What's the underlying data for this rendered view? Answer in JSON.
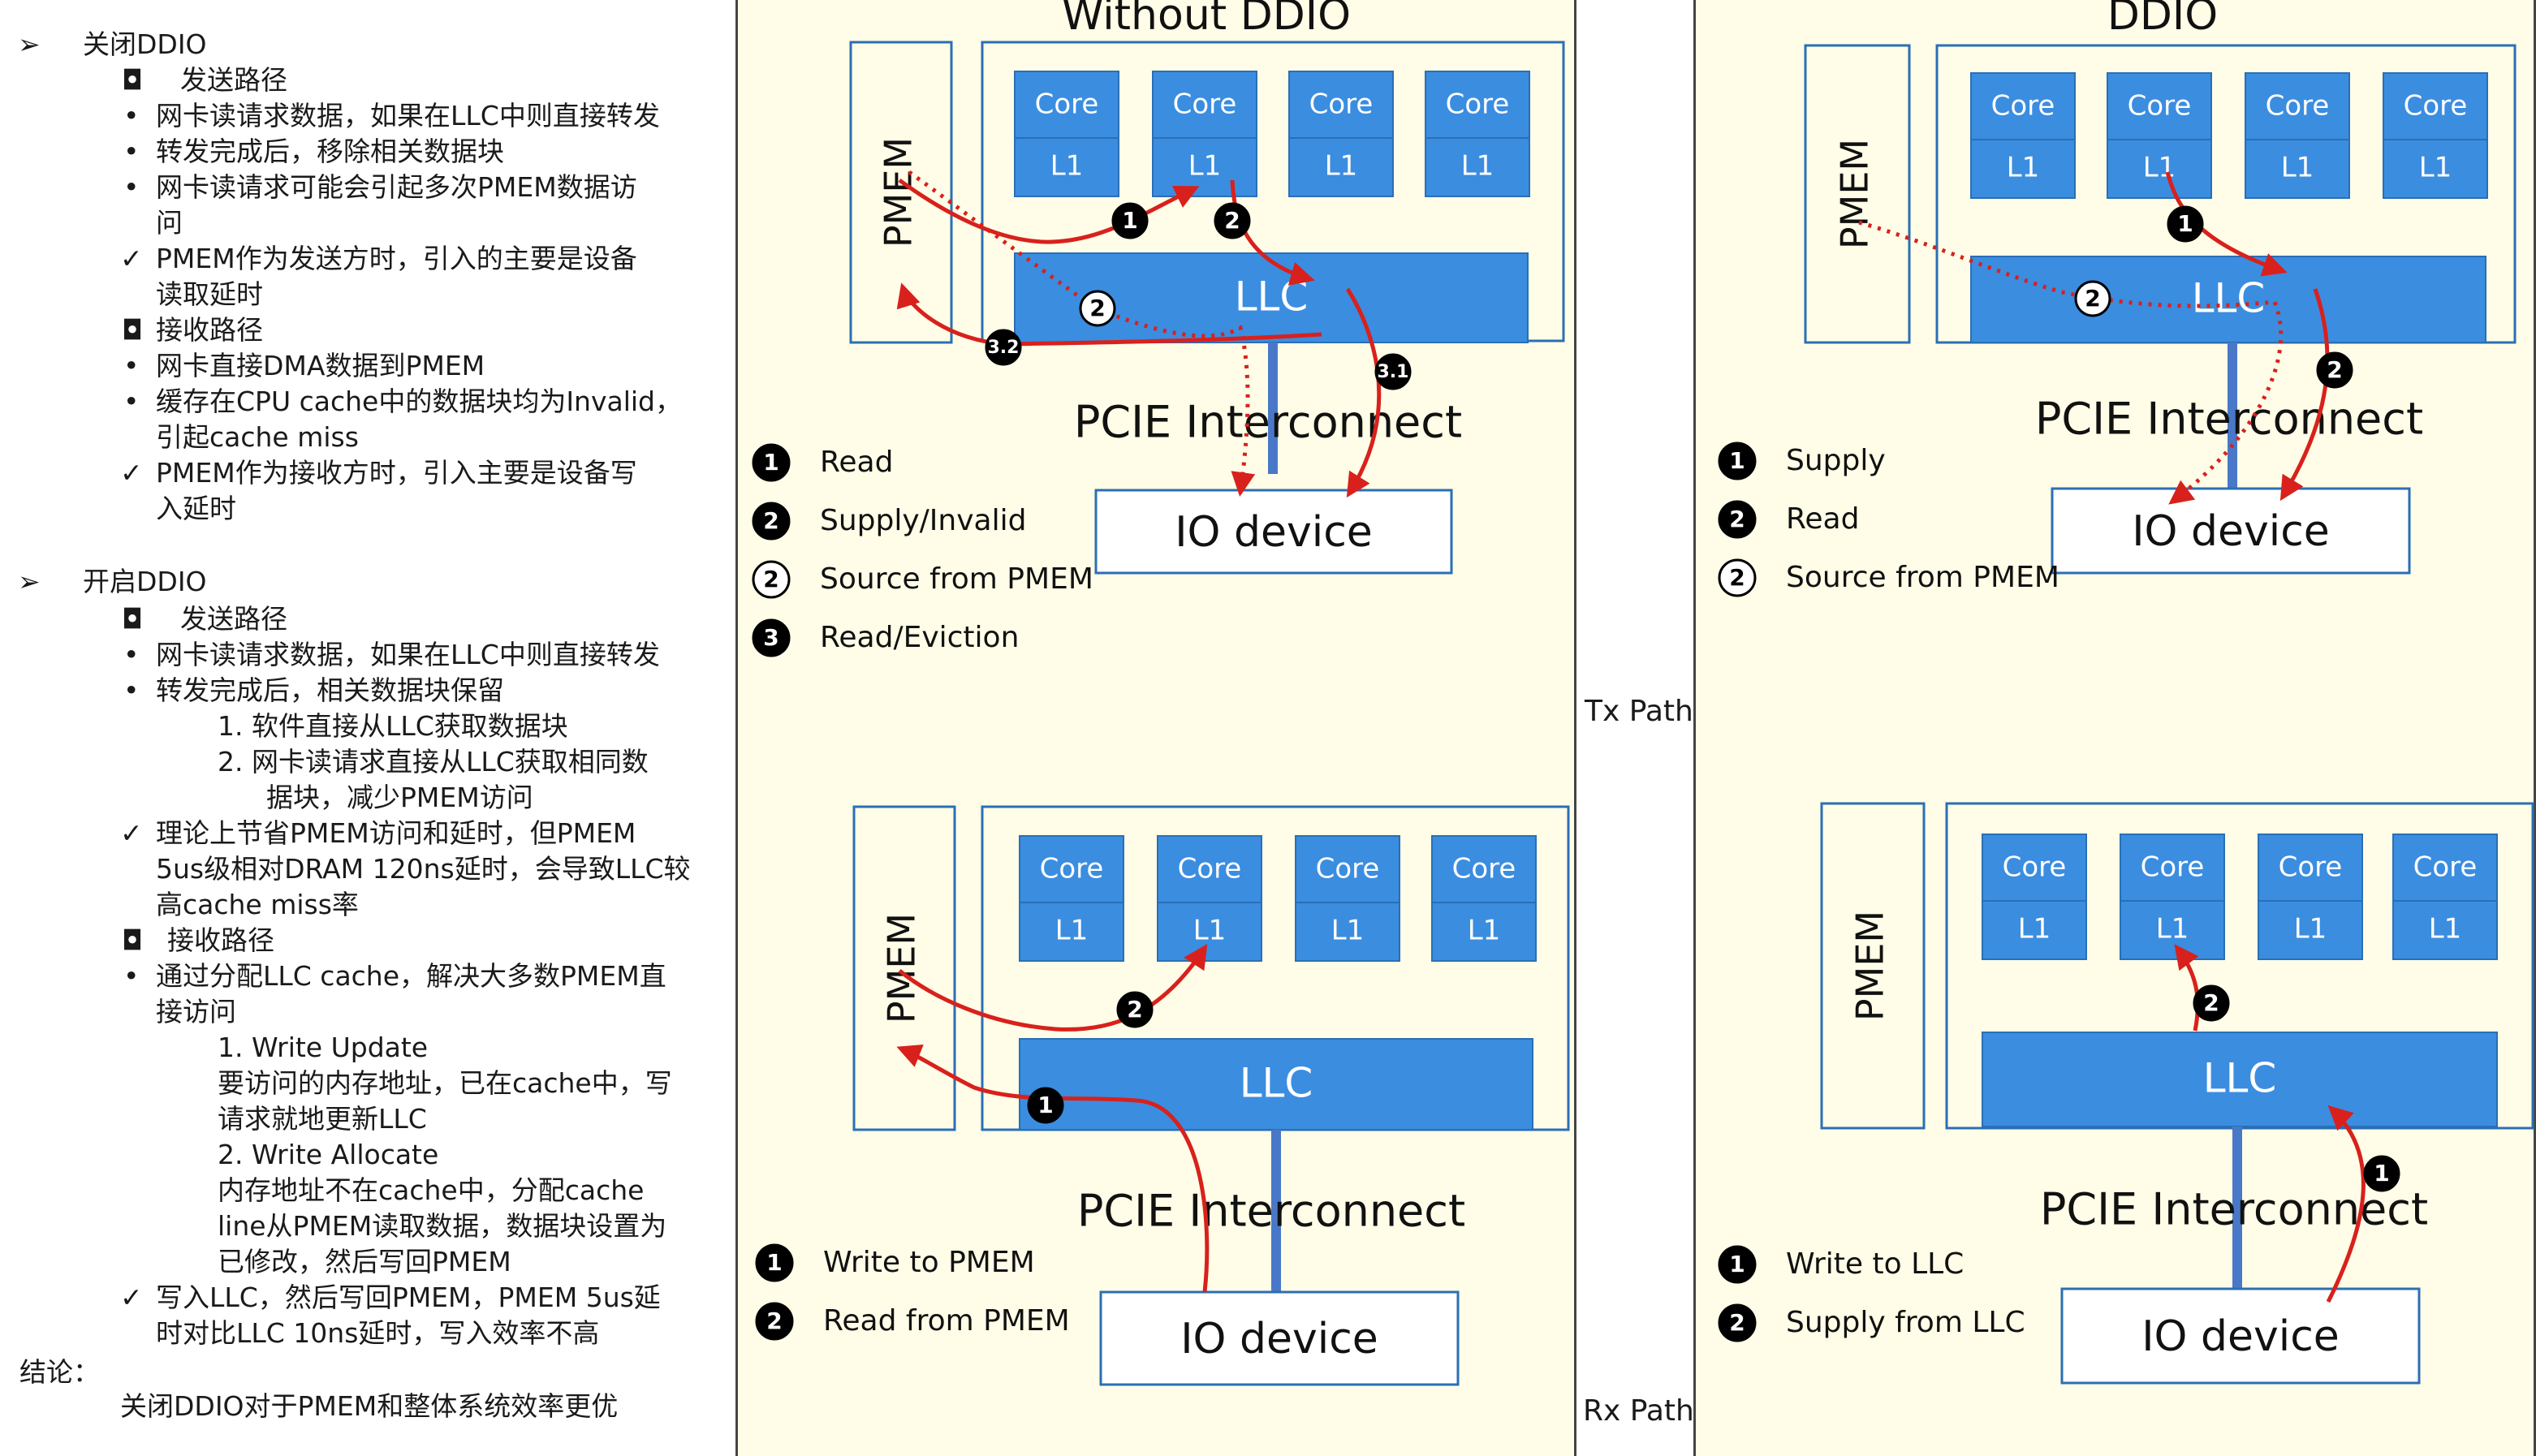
{
  "notes": {
    "heading1": "关闭DDIO",
    "sub_send1": "发送路径",
    "l1": "网卡读请求数据，如果在LLC中则直接转发",
    "l2": "转发完成后，移除相关数据块",
    "l3a": "网卡读请求可能会引起多次PMEM数据访",
    "l3b": "问",
    "l4a": "PMEM作为发送方时，引入的主要是设备",
    "l4b": "读取延时",
    "sub_recv1": "接收路径",
    "l5": "网卡直接DMA数据到PMEM",
    "l6a": "缓存在CPU cache中的数据块均为Invalid，",
    "l6b": "引起cache miss",
    "l7a": "PMEM作为接收方时，引入主要是设备写",
    "l7b": "入延时",
    "heading2": "开启DDIO",
    "sub_send2": "发送路径",
    "l8": "网卡读请求数据，如果在LLC中则直接转发",
    "l9": "转发完成后，相关数据块保留",
    "n1": "1.   软件直接从LLC获取数据块",
    "n2a": "2.   网卡读请求直接从LLC获取相同数",
    "n2b": "据块，减少PMEM访问",
    "l10a": "理论上节省PMEM访问和延时，但PMEM",
    "l10b": "5us级相对DRAM 120ns延时，会导致LLC较",
    "l10c": "高cache miss率",
    "sub_recv2": "接收路径",
    "l11a": "通过分配LLC cache，解决大多数PMEM直",
    "l11b": "接访问",
    "w1": "1.   Write Update",
    "w1a": "要访问的内存地址，已在cache中，写",
    "w1b": "请求就地更新LLC",
    "w2": "2.   Write Allocate",
    "w2a": "内存地址不在cache中，分配cache",
    "w2b": "line从PMEM读取数据，数据块设置为",
    "w2c": "已修改，然后写回PMEM",
    "l12a": "写入LLC，然后写回PMEM，PMEM 5us延",
    "l12b": "时对比LLC 10ns延时，写入效率不高",
    "conclusion_label": "结论：",
    "conclusion_text": "关闭DDIO对于PMEM和整体系统效率更优"
  },
  "panels": {
    "left_title": "Without DDIO",
    "right_title": "DDIO"
  },
  "labels": {
    "core": "Core",
    "l1": "L1",
    "llc": "LLC",
    "pmem": "PMEM",
    "pcie": "PCIE Interconnect",
    "io": "IO device",
    "tx_path": "Tx Path",
    "rx_path": "Rx Path"
  },
  "badges": {
    "b1": "1",
    "b2": "2",
    "b31": "3.1",
    "b32": "3.2"
  },
  "legends": {
    "tx_no_ddio": [
      {
        "num": "1",
        "style": "filled",
        "text": "Read"
      },
      {
        "num": "2",
        "style": "filled",
        "text": "Supply/Invalid"
      },
      {
        "num": "2",
        "style": "outline",
        "text": "Source from PMEM"
      },
      {
        "num": "3",
        "style": "filled",
        "text": "Read/Eviction"
      }
    ],
    "tx_ddio": [
      {
        "num": "1",
        "style": "filled",
        "text": "Supply"
      },
      {
        "num": "2",
        "style": "filled",
        "text": "Read"
      },
      {
        "num": "2",
        "style": "outline",
        "text": "Source from PMEM"
      }
    ],
    "rx_no_ddio": [
      {
        "num": "1",
        "style": "filled",
        "text": "Write to PMEM"
      },
      {
        "num": "2",
        "style": "filled",
        "text": "Read from PMEM"
      }
    ],
    "rx_ddio": [
      {
        "num": "1",
        "style": "filled",
        "text": "Write to LLC"
      },
      {
        "num": "2",
        "style": "filled",
        "text": "Supply from LLC"
      }
    ]
  },
  "colors": {
    "block_blue": "#3b8de0",
    "block_border": "#2a6fb5",
    "arrow_red": "#d8211c",
    "panel_bg": "#fffde7"
  }
}
